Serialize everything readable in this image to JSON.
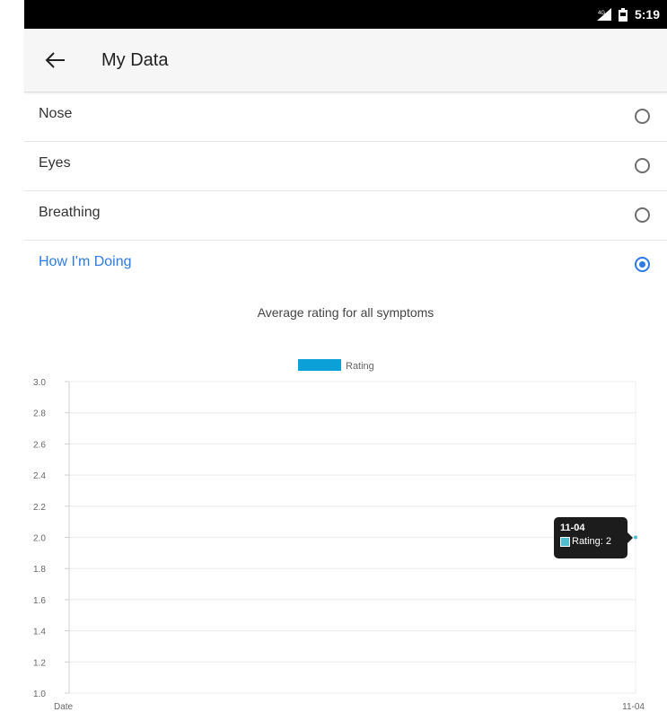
{
  "status_bar": {
    "time": "5:19",
    "icons": [
      "signal-icon",
      "battery-icon"
    ]
  },
  "app_bar": {
    "title": "My Data",
    "back_icon": "arrow-left-icon"
  },
  "options": [
    {
      "label": "Nose",
      "selected": false
    },
    {
      "label": "Eyes",
      "selected": false
    },
    {
      "label": "Breathing",
      "selected": false
    },
    {
      "label": "How I'm Doing",
      "selected": true
    }
  ],
  "colors": {
    "accent": "#2d7be5",
    "series": "#0ba0d8",
    "tooltip_bg": "#1c1c1c"
  },
  "chart_data": {
    "type": "line",
    "title": "Average rating for all symptoms",
    "xlabel": "Date",
    "x": [
      "11-04"
    ],
    "series": [
      {
        "name": "Rating",
        "values": [
          2
        ]
      }
    ],
    "ylim": [
      1.0,
      3.0
    ],
    "yticks": [
      "3.0",
      "2.8",
      "2.6",
      "2.4",
      "2.2",
      "2.0",
      "1.8",
      "1.6",
      "1.4",
      "1.2",
      "1.0"
    ],
    "grid": true,
    "legend": "top-center",
    "tooltip": {
      "title": "11-04",
      "text": "Rating: 2"
    }
  }
}
